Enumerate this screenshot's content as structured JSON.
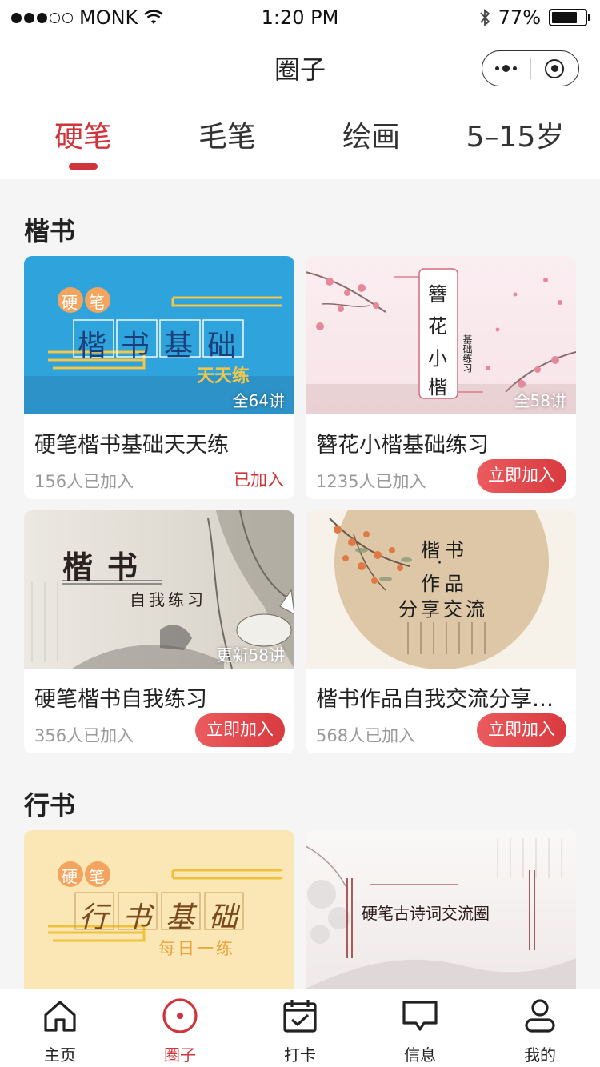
{
  "status_bar": {
    "carrier": "MONK",
    "time": "1:20 PM",
    "battery": "77%",
    "battery_level": 0.77
  },
  "header": {
    "title": "圈子"
  },
  "tabs": [
    {
      "label": "硬笔",
      "active": true
    },
    {
      "label": "毛笔",
      "active": false
    },
    {
      "label": "绘画",
      "active": false
    },
    {
      "label": "5–15岁",
      "active": false
    }
  ],
  "sections": [
    {
      "title": "楷书",
      "cards": [
        {
          "name": "硬笔楷书基础天天练",
          "lessons": "全64讲",
          "members": "156人已加入",
          "action": "已加入",
          "joined": true,
          "cover": {
            "tag1": "硬",
            "tag2": "笔",
            "chars": [
              "楷",
              "书",
              "基",
              "础"
            ],
            "subtitle": "天天练"
          }
        },
        {
          "name": "簪花小楷基础练习",
          "lessons": "全58讲",
          "members": "1235人已加入",
          "action": "立即加入",
          "joined": false,
          "cover": {
            "chars": [
              "簪",
              "花",
              "小",
              "楷"
            ],
            "side": "基础练习"
          }
        },
        {
          "name": "硬笔楷书自我练习",
          "lessons": "更新58讲",
          "members": "356人已加入",
          "action": "立即加入",
          "joined": false,
          "cover": {
            "chars": [
              "楷",
              "书"
            ],
            "subtitle": "自我练习"
          }
        },
        {
          "name": "楷书作品自我交流分享…",
          "lessons": "",
          "members": "568人已加入",
          "action": "立即加入",
          "joined": false,
          "cover": {
            "line1": "楷书",
            "line2": "·",
            "line3": "作品",
            "line4": "分享交流"
          }
        }
      ]
    },
    {
      "title": "行书",
      "cards": [
        {
          "name": "",
          "cover": {
            "tag1": "硬",
            "tag2": "笔",
            "chars": [
              "行",
              "书",
              "基",
              "础"
            ],
            "subtitle": "每日一练"
          }
        },
        {
          "name": "",
          "cover": {
            "text": "硬笔古诗词交流圈"
          }
        }
      ]
    }
  ],
  "tabbar": [
    {
      "label": "主页",
      "icon": "home-icon",
      "active": false
    },
    {
      "label": "圈子",
      "icon": "circle-target-icon",
      "active": true
    },
    {
      "label": "打卡",
      "icon": "calendar-check-icon",
      "active": false
    },
    {
      "label": "信息",
      "icon": "message-icon",
      "active": false
    },
    {
      "label": "我的",
      "icon": "user-icon",
      "active": false
    }
  ],
  "colors": {
    "accent": "#d0333a",
    "blue_cover": "#2fa3db",
    "yellow_cover": "#fbe7b5",
    "beige_cover": "#ddc7a6"
  }
}
